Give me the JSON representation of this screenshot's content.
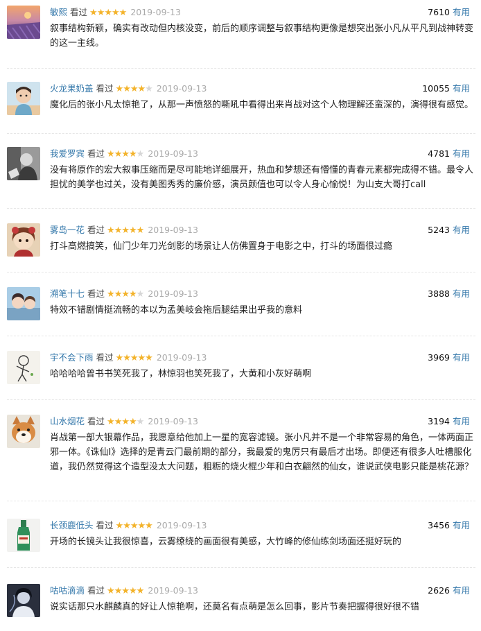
{
  "common": {
    "watched_label": "看过",
    "useful_label": "有用"
  },
  "comments": [
    {
      "user": "敏熙",
      "stars": 5,
      "date": "2019-09-13",
      "votes": "7610",
      "text": "叙事结构新颖，确实有改动但内核没变，前后的顺序调整与叙事结构更像是想突出张小凡从平凡到战神转变的这一主线。",
      "avatar": "lavender-field-avatar"
    },
    {
      "user": "火龙果奶盖",
      "stars": 4,
      "date": "2019-09-13",
      "votes": "10055",
      "text": "魔化后的张小凡太惊艳了，从那一声愤怒的嘶吼中看得出来肖战对这个人物理解还蛮深的，演得很有感觉。",
      "avatar": "child-photo-avatar"
    },
    {
      "user": "我爱罗宾",
      "stars": 4,
      "date": "2019-09-13",
      "votes": "4781",
      "text": "没有将原作的宏大叙事压缩而是尽可能地详细展开，热血和梦想还有懵懂的青春元素都完成得不错。最令人担忧的美学也过关，没有美图秀秀的廉价感，演员颜值也可以令人身心愉悦！为山支大哥打call",
      "avatar": "bw-photo-avatar"
    },
    {
      "user": "雾岛一花",
      "stars": 5,
      "date": "2019-09-13",
      "votes": "5243",
      "text": "打斗高燃搞笑，仙门少年刀光剑影的场景让人仿佛置身于电影之中，打斗的场面很过瘾",
      "avatar": "anime-girl-avatar"
    },
    {
      "user": "溯笔十七",
      "stars": 4,
      "date": "2019-09-13",
      "votes": "3888",
      "text": "特效不错剧情挺流畅的本以为孟美岐会拖后腿结果出乎我的意料",
      "avatar": "anime-couple-avatar"
    },
    {
      "user": "宇不会下雨",
      "stars": 5,
      "date": "2019-09-13",
      "votes": "3969",
      "text": "哈哈哈哈曾书书笑死我了，林惊羽也笑死我了，大黄和小灰好萌啊",
      "avatar": "sketch-figure-avatar"
    },
    {
      "user": "山水烟花",
      "stars": 4,
      "date": "2019-09-13",
      "votes": "3194",
      "text": "肖战第一部大银幕作品，我愿意给他加上一星的宽容滤镜。张小凡并不是一个非常容易的角色，一体两面正邪一体。《诛仙Ⅰ》选择的是青云门最前期的部分，我最爱的鬼厉只有最后才出场。即便还有很多人吐槽服化道，我仍然觉得这个造型没太大问题，粗粝的烧火棍少年和白衣翩然的仙女，谁说武侠电影只能是桃花源？",
      "avatar": "shiba-dog-avatar"
    },
    {
      "user": "长颈鹿低头",
      "stars": 5,
      "date": "2019-09-13",
      "votes": "3456",
      "text": "开场的长镜头让我很惊喜，云雾缭绕的画面很有美感，大竹峰的修仙练剑场面还挺好玩的",
      "avatar": "bottle-avatar"
    },
    {
      "user": "咕咕滴滴",
      "stars": 5,
      "date": "2019-09-13",
      "votes": "2626",
      "text": "说实话那只水麒麟真的好让人惊艳啊，还莫名有点萌是怎么回事，影片节奏把握得很好很不错",
      "avatar": "dark-portrait-avatar"
    }
  ]
}
